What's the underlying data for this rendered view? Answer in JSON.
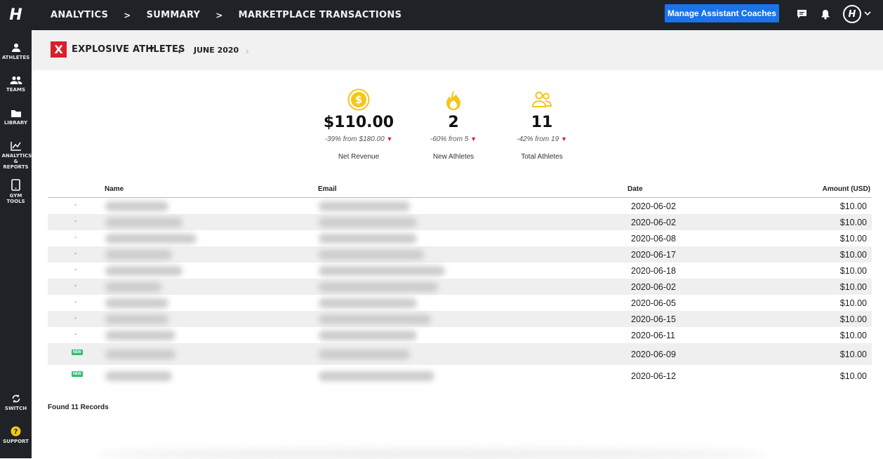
{
  "app": {
    "logo": "H"
  },
  "breadcrumb": [
    "ANALYTICS",
    "SUMMARY",
    "MARKETPLACE TRANSACTIONS"
  ],
  "breadcrumb_sep": ">",
  "header": {
    "manage_label": "Manage Assistant Coaches",
    "avatar_letter": "H",
    "icons": [
      "chat-icon",
      "bell-icon",
      "avatar-icon"
    ]
  },
  "sidebar": {
    "top": [
      {
        "label": "ATHLETES",
        "icon": "person-icon"
      },
      {
        "label": "TEAMS",
        "icon": "people-icon"
      },
      {
        "label": "LIBRARY",
        "icon": "folder-icon"
      },
      {
        "label": "ANALYTICS & REPORTS",
        "icon": "chart-line-icon"
      },
      {
        "label": "GYM TOOLS",
        "icon": "tablet-icon"
      }
    ],
    "bottom": [
      {
        "label": "SWITCH",
        "icon": "sync-icon"
      },
      {
        "label": "SUPPORT",
        "icon": "help-icon"
      }
    ]
  },
  "team": {
    "badge": "X",
    "name": "EXPLOSIVE ATHLETES",
    "badge_color": "#d91f2b"
  },
  "month": {
    "prev": "‹",
    "label": "JUNE 2020",
    "next": "›"
  },
  "stats": [
    {
      "icon": "dollar-coin-icon",
      "value": "$110.00",
      "delta": "-39% from $180.00",
      "label": "Net Revenue"
    },
    {
      "icon": "flame-icon",
      "value": "2",
      "delta": "-60% from 5",
      "label": "New Athletes"
    },
    {
      "icon": "people-outline-icon",
      "value": "11",
      "delta": "-42% from 19",
      "label": "Total Athletes"
    }
  ],
  "table": {
    "headers": {
      "name": "Name",
      "email": "Email",
      "date": "Date",
      "amount": "Amount (USD)"
    },
    "rows": [
      {
        "marker": "-",
        "date": "2020-06-02",
        "amount": "$10.00"
      },
      {
        "marker": "-",
        "date": "2020-06-02",
        "amount": "$10.00"
      },
      {
        "marker": "-",
        "date": "2020-06-08",
        "amount": "$10.00"
      },
      {
        "marker": "-",
        "date": "2020-06-17",
        "amount": "$10.00"
      },
      {
        "marker": "-",
        "date": "2020-06-18",
        "amount": "$10.00"
      },
      {
        "marker": "-",
        "date": "2020-06-02",
        "amount": "$10.00"
      },
      {
        "marker": "-",
        "date": "2020-06-05",
        "amount": "$10.00"
      },
      {
        "marker": "-",
        "date": "2020-06-15",
        "amount": "$10.00"
      },
      {
        "marker": "-",
        "date": "2020-06-11",
        "amount": "$10.00"
      },
      {
        "marker": "NEW",
        "date": "2020-06-09",
        "amount": "$10.00"
      },
      {
        "marker": "NEW",
        "date": "2020-06-12",
        "amount": "$10.00"
      }
    ]
  },
  "footer": {
    "found": "Found 11 Records"
  },
  "colors": {
    "accent": "#1a73e8",
    "brand_dark": "#1f2327",
    "gold": "#f5c518",
    "down": "#d91f2b",
    "new_badge": "#2fbf71"
  }
}
